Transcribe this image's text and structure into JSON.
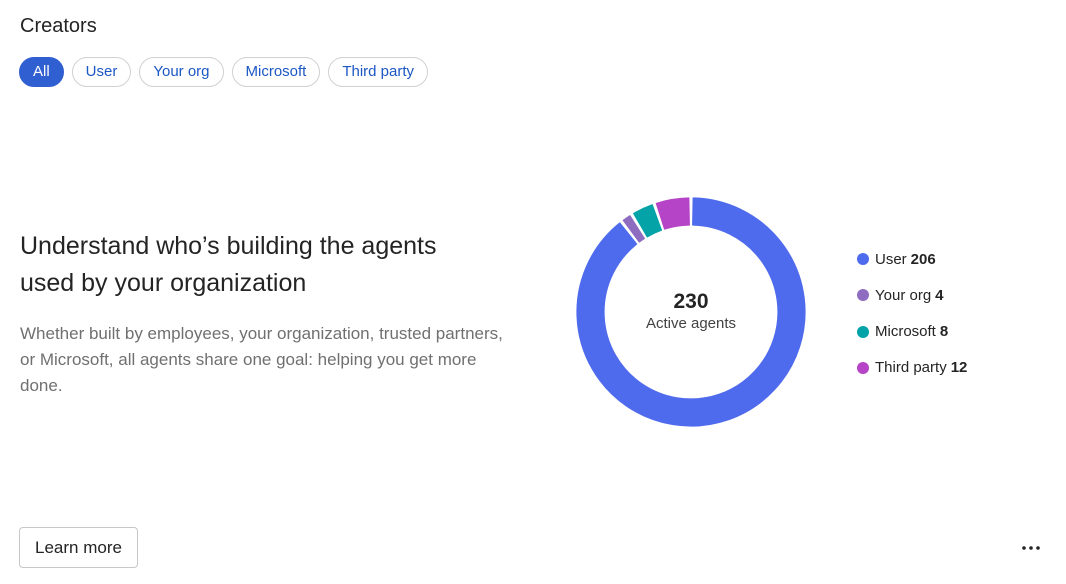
{
  "section": {
    "title": "Creators"
  },
  "filters": {
    "items": [
      {
        "label": "All",
        "selected": true
      },
      {
        "label": "User",
        "selected": false
      },
      {
        "label": "Your org",
        "selected": false
      },
      {
        "label": "Microsoft",
        "selected": false
      },
      {
        "label": "Third party",
        "selected": false
      }
    ]
  },
  "intro": {
    "headline": "Understand who’s building the agents used by your organization",
    "description": "Whether built by employees, your organization, trusted partners, or Microsoft, all agents share one goal: helping you get more done."
  },
  "chart_data": {
    "type": "pie",
    "center_value": "230",
    "center_label": "Active agents",
    "series": [
      {
        "name": "User",
        "value": 206,
        "color": "#4f6bed"
      },
      {
        "name": "Your org",
        "value": 4,
        "color": "#8e6cbf"
      },
      {
        "name": "Microsoft",
        "value": 8,
        "color": "#03a3a8"
      },
      {
        "name": "Third party",
        "value": 12,
        "color": "#b544c6"
      }
    ]
  },
  "legend": {
    "items": [
      {
        "label": "User",
        "value": "206",
        "color": "#4f6bed"
      },
      {
        "label": "Your org",
        "value": "4",
        "color": "#8e6cbf"
      },
      {
        "label": "Microsoft",
        "value": "8",
        "color": "#03a3a8"
      },
      {
        "label": "Third party",
        "value": "12",
        "color": "#b544c6"
      }
    ]
  },
  "footer": {
    "learn_more_label": "Learn more",
    "more_icon": "more-horizontal-icon"
  }
}
